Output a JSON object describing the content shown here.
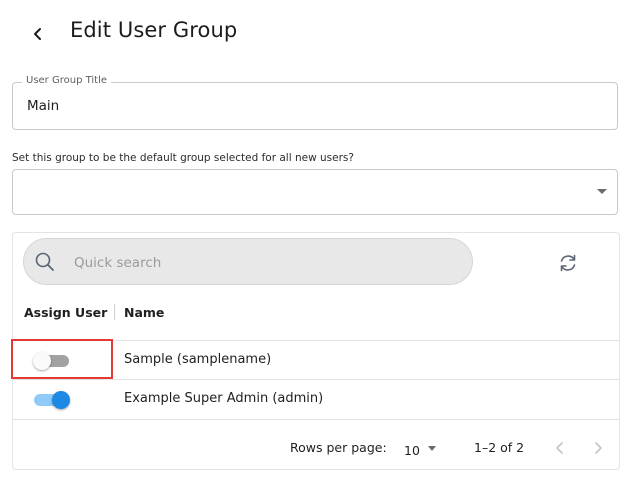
{
  "header": {
    "title": "Edit User Group",
    "back_icon": "chevron-left-icon"
  },
  "group_title": {
    "label": "User Group Title",
    "value": "Main"
  },
  "default_group": {
    "label": "Set this group to be the default group selected for all new users?",
    "value": ""
  },
  "grid": {
    "search_placeholder": "Quick search",
    "columns": [
      "Assign User",
      "Name"
    ],
    "rows": [
      {
        "name": "Sample (samplename)",
        "assigned": false
      },
      {
        "name": "Example Super Admin (admin)",
        "assigned": true
      }
    ],
    "footer": {
      "rows_per_page_label": "Rows per page:",
      "rows_per_page": "10",
      "range": "1–2 of 2"
    }
  },
  "colors": {
    "switch_on_thumb": "#1e88e5",
    "switch_on_track": "#90caf9",
    "switch_off_track": "#a2a2a2",
    "highlight": "#e53935"
  }
}
